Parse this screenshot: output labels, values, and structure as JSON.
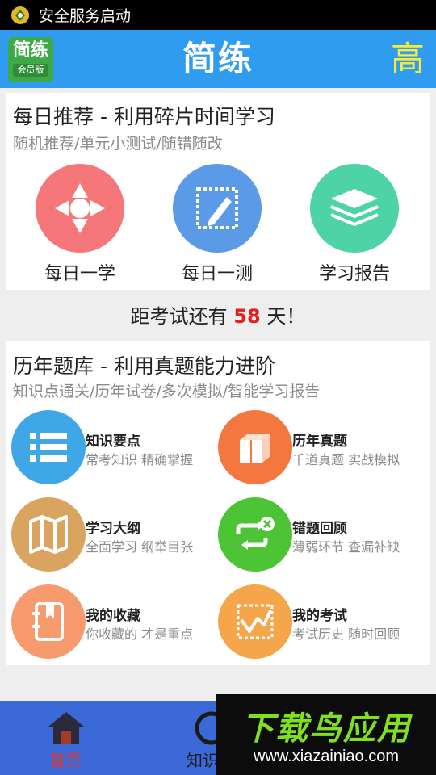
{
  "statusbar": {
    "text": "安全服务启动",
    "icon": "security-shield-icon"
  },
  "appbar": {
    "logo_main": "简练",
    "logo_sub": "会员版",
    "title": "简练",
    "level": "高"
  },
  "daily_section": {
    "title": "每日推荐 - 利用碎片时间学习",
    "subtitle": "随机推荐/单元小测试/随错随改",
    "items": [
      {
        "label": "每日一学",
        "icon": "compass-icon",
        "color": "#f5777a"
      },
      {
        "label": "每日一测",
        "icon": "edit-test-icon",
        "color": "#5a9ae6"
      },
      {
        "label": "学习报告",
        "icon": "layers-report-icon",
        "color": "#4ed3a6"
      }
    ]
  },
  "countdown": {
    "prefix": "距考试还有 ",
    "days": "58",
    "suffix": " 天！"
  },
  "bank_section": {
    "title": "历年题库 - 利用真题能力进阶",
    "subtitle": "知识点通关/历年试卷/多次模拟/智能学习报告",
    "items": [
      {
        "title": "知识要点",
        "desc": "常考知识 精确掌握",
        "icon": "list-icon",
        "color": "#3fa7e6"
      },
      {
        "title": "历年真题",
        "desc": "千道真题 实战模拟",
        "icon": "books-icon",
        "color": "#f3773f"
      },
      {
        "title": "学习大纲",
        "desc": "全面学习 纲举目张",
        "icon": "map-icon",
        "color": "#d8a460"
      },
      {
        "title": "错题回顾",
        "desc": "薄弱环节 查漏补缺",
        "icon": "retry-icon",
        "color": "#4dc436"
      },
      {
        "title": "我的收藏",
        "desc": "你收藏的 才是重点",
        "icon": "bookmark-icon",
        "color": "#f79a6e"
      },
      {
        "title": "我的考试",
        "desc": "考试历史 随时回顾",
        "icon": "chart-icon",
        "color": "#f5a54a"
      }
    ]
  },
  "bottom_nav": [
    {
      "label": "首页",
      "icon": "home-icon",
      "active": true,
      "color": "#e5342a"
    },
    {
      "label": "知识点",
      "icon": "knowledge-icon",
      "active": false,
      "color": "#1a1a1a"
    }
  ],
  "watermark": {
    "line1": "下载鸟应用",
    "line2": "www.xiazainiao.com"
  }
}
